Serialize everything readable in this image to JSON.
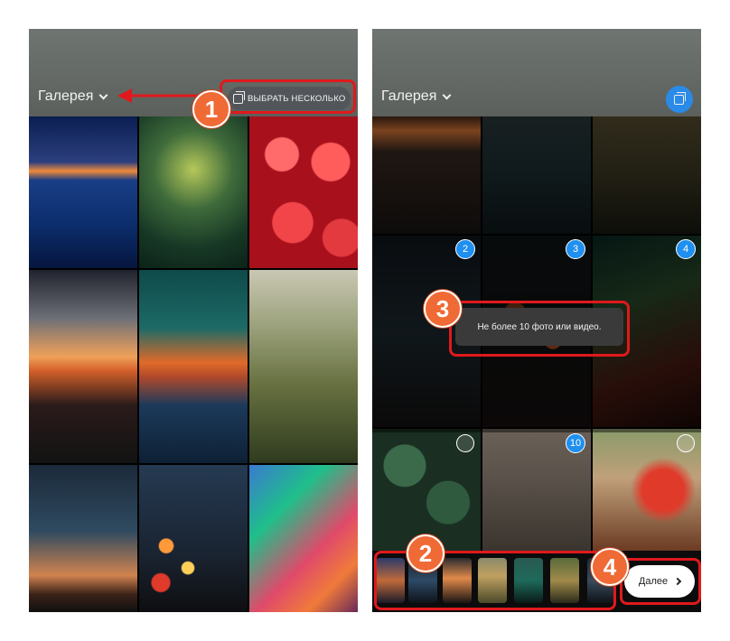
{
  "left": {
    "gallery_label": "Галерея",
    "select_multiple_label": "ВЫБРАТЬ НЕСКОЛЬКО"
  },
  "right": {
    "gallery_label": "Галерея",
    "badges": [
      "2",
      "3",
      "4",
      "10"
    ],
    "toast": "Не более 10 фото или видео.",
    "next_label": "Далее"
  },
  "markers": [
    "1",
    "2",
    "3",
    "4"
  ],
  "colors": {
    "accent": "#1f8ff0",
    "annotation_red": "#e0191c",
    "marker_orange": "#f06a35"
  }
}
